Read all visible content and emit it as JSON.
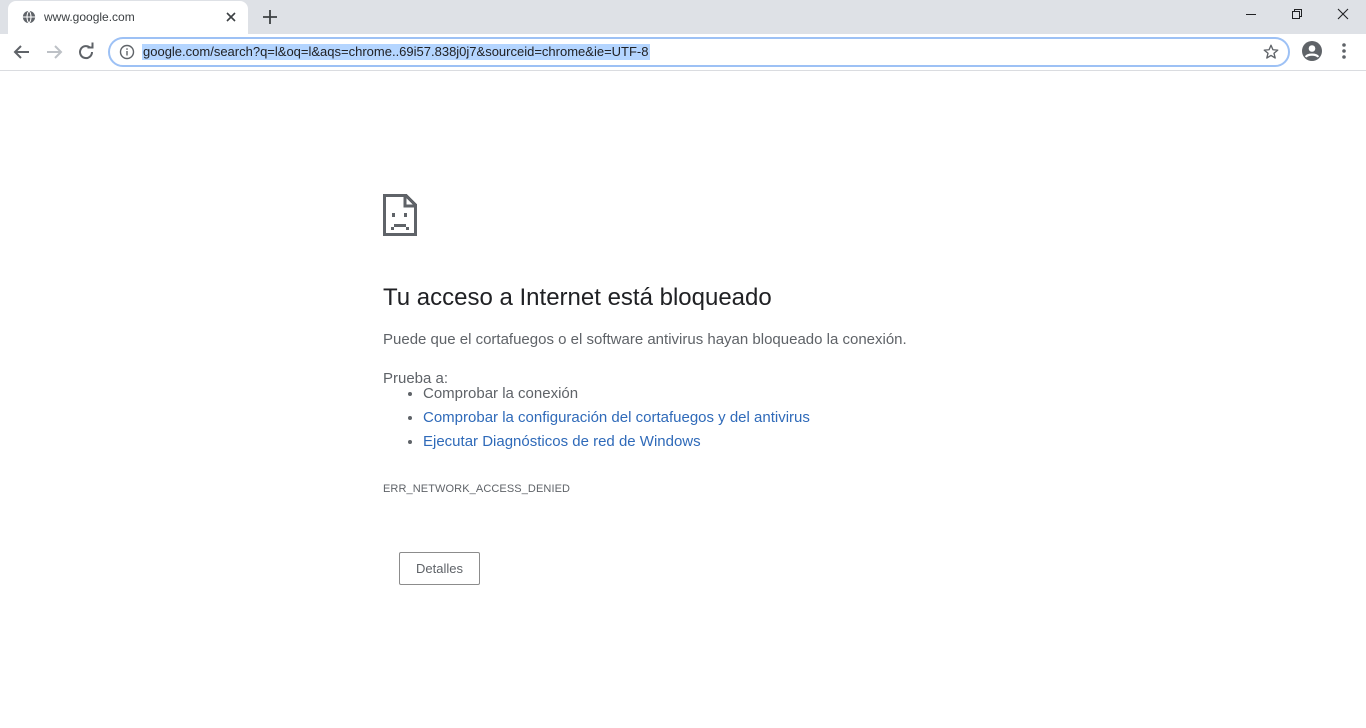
{
  "browser": {
    "tab": {
      "title": "www.google.com",
      "favicon_icon": "globe-icon"
    },
    "address_bar": {
      "url": "google.com/search?q=l&oq=l&aqs=chrome..69i57.838j0j7&sourceid=chrome&ie=UTF-8",
      "selected": true
    },
    "window_controls": [
      "minimize",
      "restore",
      "close"
    ]
  },
  "error_page": {
    "icon": "sad-page-icon",
    "headline": "Tu acceso a Internet está bloqueado",
    "description": "Puede que el cortafuegos o el software antivirus hayan bloqueado la conexión.",
    "suggestions_label": "Prueba a:",
    "suggestions": [
      {
        "text": "Comprobar la conexión",
        "link": false
      },
      {
        "text": "Comprobar la configuración del cortafuegos y del antivirus",
        "link": true
      },
      {
        "text": "Ejecutar Diagnósticos de red de Windows",
        "link": true
      }
    ],
    "error_code": "ERR_NETWORK_ACCESS_DENIED",
    "details_button": "Detalles"
  },
  "colors": {
    "link": "#2f6ab9",
    "url_selection": "#b4d5ff",
    "tabstrip": "#dee1e6"
  }
}
